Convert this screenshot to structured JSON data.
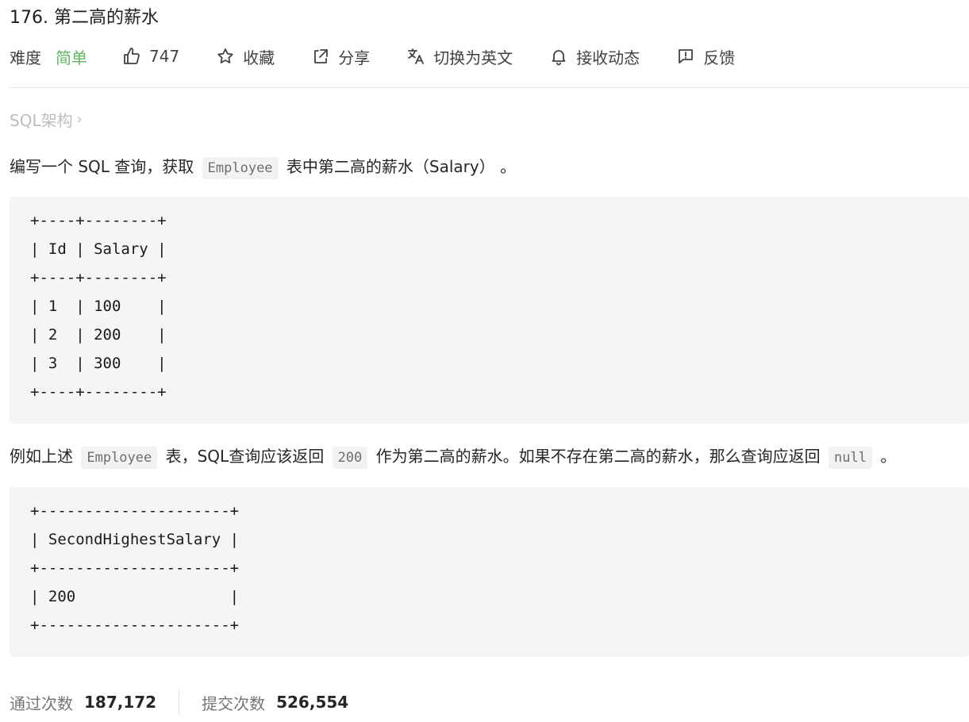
{
  "problem": {
    "title": "176. 第二高的薪水"
  },
  "meta": {
    "difficulty_label": "难度",
    "difficulty_value": "简单",
    "difficulty_color": "#5cb85c",
    "likes": "747",
    "favorite_label": "收藏",
    "share_label": "分享",
    "switch_lang_label": "切换为英文",
    "subscribe_label": "接收动态",
    "feedback_label": "反馈"
  },
  "breadcrumb": {
    "label": "SQL架构",
    "chevron": "›"
  },
  "description": {
    "p1_a": "编写一个 SQL 查询，获取",
    "p1_code": "Employee",
    "p1_b": "表中第二高的薪水（Salary） 。",
    "table1": "+----+--------+\n| Id | Salary |\n+----+--------+\n| 1  | 100    |\n| 2  | 200    |\n| 3  | 300    |\n+----+--------+",
    "p2_a": "例如上述",
    "p2_code1": "Employee",
    "p2_b": "表，SQL查询应该返回",
    "p2_code2": "200",
    "p2_c": "作为第二高的薪水。如果不存在第二高的薪水，那么查询应返回",
    "p2_code3": "null",
    "p2_d": "。",
    "table2": "+---------------------+\n| SecondHighestSalary |\n+---------------------+\n| 200                 |\n+---------------------+"
  },
  "stats": {
    "accepted_label": "通过次数",
    "accepted_value": "187,172",
    "submitted_label": "提交次数",
    "submitted_value": "526,554"
  }
}
